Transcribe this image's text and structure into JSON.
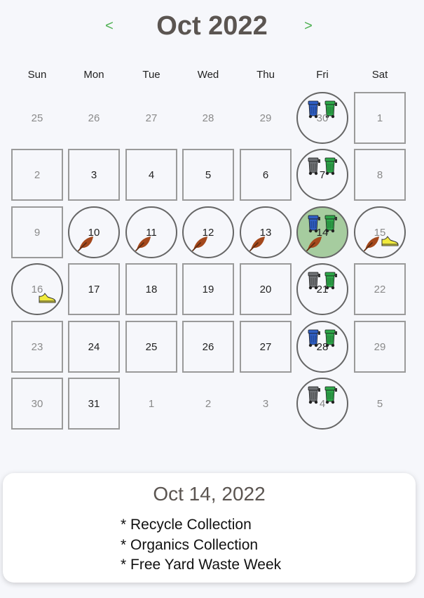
{
  "header": {
    "title": "Oct 2022",
    "prev_label": "<",
    "next_label": ">"
  },
  "weekdays": [
    "Sun",
    "Mon",
    "Tue",
    "Wed",
    "Thu",
    "Fri",
    "Sat"
  ],
  "colors": {
    "accent": "#4caf50",
    "selected_day": "#a6cc9f",
    "recycle_bin": "#2f5fc4",
    "garbage_bin": "#6f7275",
    "organics_bin": "#2ea84a",
    "leaf": "#a4481c",
    "shoe": "#f0ea3c"
  },
  "weeks": [
    [
      {
        "day": "25",
        "muted": true,
        "shape": "none",
        "icons": []
      },
      {
        "day": "26",
        "muted": true,
        "shape": "none",
        "icons": []
      },
      {
        "day": "27",
        "muted": true,
        "shape": "none",
        "icons": []
      },
      {
        "day": "28",
        "muted": true,
        "shape": "none",
        "icons": []
      },
      {
        "day": "29",
        "muted": true,
        "shape": "none",
        "icons": []
      },
      {
        "day": "30",
        "muted": true,
        "shape": "circle",
        "icons": [
          "recycle-bin",
          "organics-bin"
        ]
      },
      {
        "day": "1",
        "muted": true,
        "shape": "square",
        "icons": []
      }
    ],
    [
      {
        "day": "2",
        "muted": true,
        "shape": "square",
        "icons": []
      },
      {
        "day": "3",
        "muted": false,
        "shape": "square",
        "icons": []
      },
      {
        "day": "4",
        "muted": false,
        "shape": "square",
        "icons": []
      },
      {
        "day": "5",
        "muted": false,
        "shape": "square",
        "icons": []
      },
      {
        "day": "6",
        "muted": false,
        "shape": "square",
        "icons": []
      },
      {
        "day": "7",
        "muted": false,
        "shape": "circle",
        "icons": [
          "garbage-bin",
          "organics-bin"
        ]
      },
      {
        "day": "8",
        "muted": true,
        "shape": "square",
        "icons": []
      }
    ],
    [
      {
        "day": "9",
        "muted": true,
        "shape": "square",
        "icons": []
      },
      {
        "day": "10",
        "muted": false,
        "shape": "circle",
        "icons": [
          "leaf"
        ]
      },
      {
        "day": "11",
        "muted": false,
        "shape": "circle",
        "icons": [
          "leaf"
        ]
      },
      {
        "day": "12",
        "muted": false,
        "shape": "circle",
        "icons": [
          "leaf"
        ]
      },
      {
        "day": "13",
        "muted": false,
        "shape": "circle",
        "icons": [
          "leaf"
        ]
      },
      {
        "day": "14",
        "muted": false,
        "shape": "circle",
        "selected": true,
        "icons": [
          "recycle-bin",
          "organics-bin",
          "leaf"
        ]
      },
      {
        "day": "15",
        "muted": true,
        "shape": "circle",
        "icons": [
          "leaf",
          "shoe"
        ]
      }
    ],
    [
      {
        "day": "16",
        "muted": true,
        "shape": "circle",
        "icons": [
          "shoe"
        ]
      },
      {
        "day": "17",
        "muted": false,
        "shape": "square",
        "icons": []
      },
      {
        "day": "18",
        "muted": false,
        "shape": "square",
        "icons": []
      },
      {
        "day": "19",
        "muted": false,
        "shape": "square",
        "icons": []
      },
      {
        "day": "20",
        "muted": false,
        "shape": "square",
        "icons": []
      },
      {
        "day": "21",
        "muted": false,
        "shape": "circle",
        "icons": [
          "garbage-bin",
          "organics-bin"
        ]
      },
      {
        "day": "22",
        "muted": true,
        "shape": "square",
        "icons": []
      }
    ],
    [
      {
        "day": "23",
        "muted": true,
        "shape": "square",
        "icons": []
      },
      {
        "day": "24",
        "muted": false,
        "shape": "square",
        "icons": []
      },
      {
        "day": "25",
        "muted": false,
        "shape": "square",
        "icons": []
      },
      {
        "day": "26",
        "muted": false,
        "shape": "square",
        "icons": []
      },
      {
        "day": "27",
        "muted": false,
        "shape": "square",
        "icons": []
      },
      {
        "day": "28",
        "muted": false,
        "shape": "circle",
        "icons": [
          "recycle-bin",
          "organics-bin"
        ]
      },
      {
        "day": "29",
        "muted": true,
        "shape": "square",
        "icons": []
      }
    ],
    [
      {
        "day": "30",
        "muted": true,
        "shape": "square",
        "icons": []
      },
      {
        "day": "31",
        "muted": false,
        "shape": "square",
        "icons": []
      },
      {
        "day": "1",
        "muted": true,
        "shape": "none",
        "icons": []
      },
      {
        "day": "2",
        "muted": true,
        "shape": "none",
        "icons": []
      },
      {
        "day": "3",
        "muted": true,
        "shape": "none",
        "icons": []
      },
      {
        "day": "4",
        "muted": true,
        "shape": "circle",
        "icons": [
          "garbage-bin",
          "organics-bin"
        ]
      },
      {
        "day": "5",
        "muted": true,
        "shape": "none",
        "icons": []
      }
    ]
  ],
  "detail": {
    "date": "Oct 14, 2022",
    "items": [
      "* Recycle Collection",
      "* Organics Collection",
      "* Free Yard Waste Week"
    ]
  }
}
